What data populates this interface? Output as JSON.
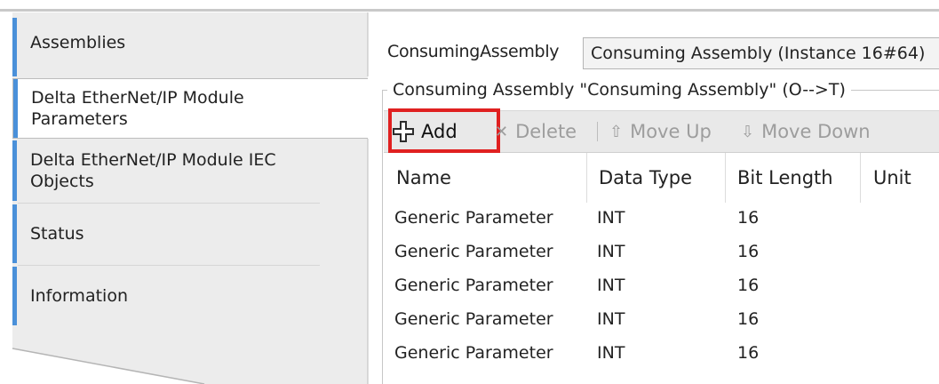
{
  "sidebar": {
    "items": [
      {
        "label": "Assemblies"
      },
      {
        "label": "Delta EtherNet/IP Module Parameters"
      },
      {
        "label": "Delta EtherNet/IP Module IEC Objects"
      },
      {
        "label": "Status"
      },
      {
        "label": "Information"
      }
    ]
  },
  "main": {
    "consuming_label": "ConsumingAssembly",
    "consuming_value": "Consuming Assembly (Instance 16#64)",
    "group_title": "Consuming Assembly \"Consuming Assembly\" (O-->T)",
    "toolbar": {
      "add": "Add",
      "delete": "Delete",
      "move_up": "Move Up",
      "move_down": "Move Down"
    },
    "table": {
      "columns": [
        "Name",
        "Data Type",
        "Bit Length",
        "Unit"
      ],
      "rows": [
        {
          "name": "Generic Parameter",
          "type": "INT",
          "bits": "16",
          "unit": ""
        },
        {
          "name": "Generic Parameter",
          "type": "INT",
          "bits": "16",
          "unit": ""
        },
        {
          "name": "Generic Parameter",
          "type": "INT",
          "bits": "16",
          "unit": ""
        },
        {
          "name": "Generic Parameter",
          "type": "INT",
          "bits": "16",
          "unit": ""
        },
        {
          "name": "Generic Parameter",
          "type": "INT",
          "bits": "16",
          "unit": ""
        }
      ]
    }
  },
  "colors": {
    "accent": "#4a90d9",
    "highlight": "#e02020",
    "sidebar_bg": "#ececec"
  }
}
